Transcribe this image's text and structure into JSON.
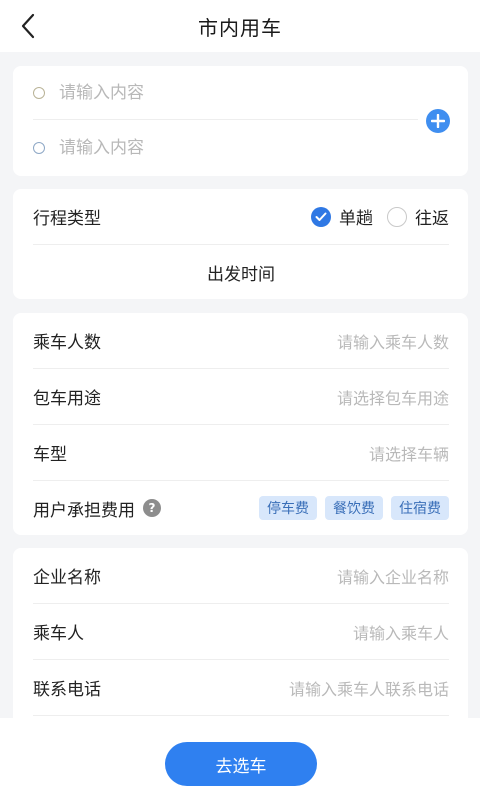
{
  "header": {
    "title": "市内用车"
  },
  "route": {
    "start_placeholder": "请输入内容",
    "end_placeholder": "请输入内容"
  },
  "trip": {
    "type_label": "行程类型",
    "options": [
      {
        "label": "单趟",
        "selected": true
      },
      {
        "label": "往返",
        "selected": false
      }
    ],
    "depart_time_label": "出发时间"
  },
  "passengers": {
    "count_label": "乘车人数",
    "count_placeholder": "请输入乘车人数",
    "purpose_label": "包车用途",
    "purpose_placeholder": "请选择包车用途",
    "car_type_label": "车型",
    "car_type_placeholder": "请选择车辆",
    "fees_label": "用户承担费用",
    "help_glyph": "?",
    "fee_tags": [
      "停车费",
      "餐饮费",
      "住宿费"
    ]
  },
  "company": {
    "name_label": "企业名称",
    "name_placeholder": "请输入企业名称",
    "passenger_label": "乘车人",
    "passenger_placeholder": "请输入乘车人",
    "phone_label": "联系电话",
    "phone_placeholder": "请输入乘车人联系电话"
  },
  "footer": {
    "submit_label": "去选车"
  },
  "colors": {
    "accent": "#2f80f0",
    "tag_bg": "#d8e7fb",
    "tag_text": "#3a6fb8"
  },
  "icons": {
    "back": "back-arrow-icon",
    "add": "plus-circle-icon",
    "check": "check-icon",
    "help": "question-icon"
  }
}
